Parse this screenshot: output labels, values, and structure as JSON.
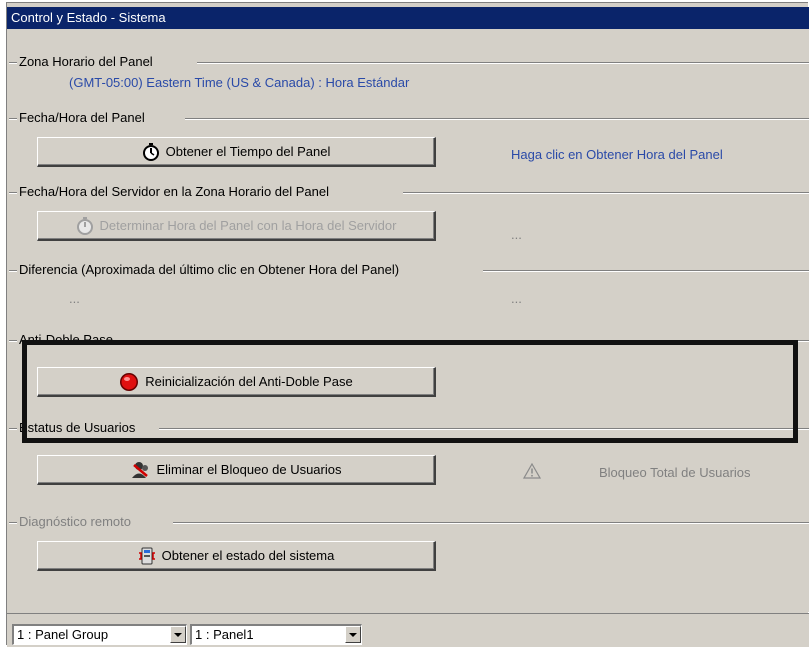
{
  "window": {
    "title": "Control y Estado - Sistema"
  },
  "timezone": {
    "label": "Zona Horario del Panel",
    "value": "(GMT-05:00) Eastern Time (US & Canada) : Hora Estándar"
  },
  "panel_time": {
    "label": "Fecha/Hora del Panel",
    "button": "Obtener el Tiempo del Panel",
    "hint": "Haga clic en Obtener Hora del Panel"
  },
  "server_time": {
    "label": "Fecha/Hora del Servidor en la Zona Horario del Panel",
    "button": "Determinar Hora del Panel con la Hora del Servidor",
    "value": "..."
  },
  "difference": {
    "label": "Diferencia (Aproximada del último clic en Obtener Hora del Panel)",
    "value_left": "...",
    "value_right": "..."
  },
  "anti_passback": {
    "label": "Anti-Doble Pase",
    "button": "Reinicialización del Anti-Doble Pase"
  },
  "user_status": {
    "label": "Estatus de Usuarios",
    "button": "Eliminar el Bloqueo de Usuarios",
    "status": "Bloqueo Total de Usuarios"
  },
  "remote_diag": {
    "label": "Diagnóstico remoto",
    "button": "Obtener el estado del sistema"
  },
  "bottom": {
    "panel_group": "1 : Panel Group",
    "panel": "1 : Panel1"
  },
  "colors": {
    "title_bg": "#0a246a",
    "info_text": "#2a4aa8",
    "highlight": "#111111"
  },
  "icons": {
    "panel_time": "stopwatch-icon",
    "server_time": "stopwatch-icon",
    "anti_passback": "red-button-icon",
    "user_status": "users-icon",
    "warning": "warning-icon",
    "remote_diag": "diagnostic-icon"
  }
}
